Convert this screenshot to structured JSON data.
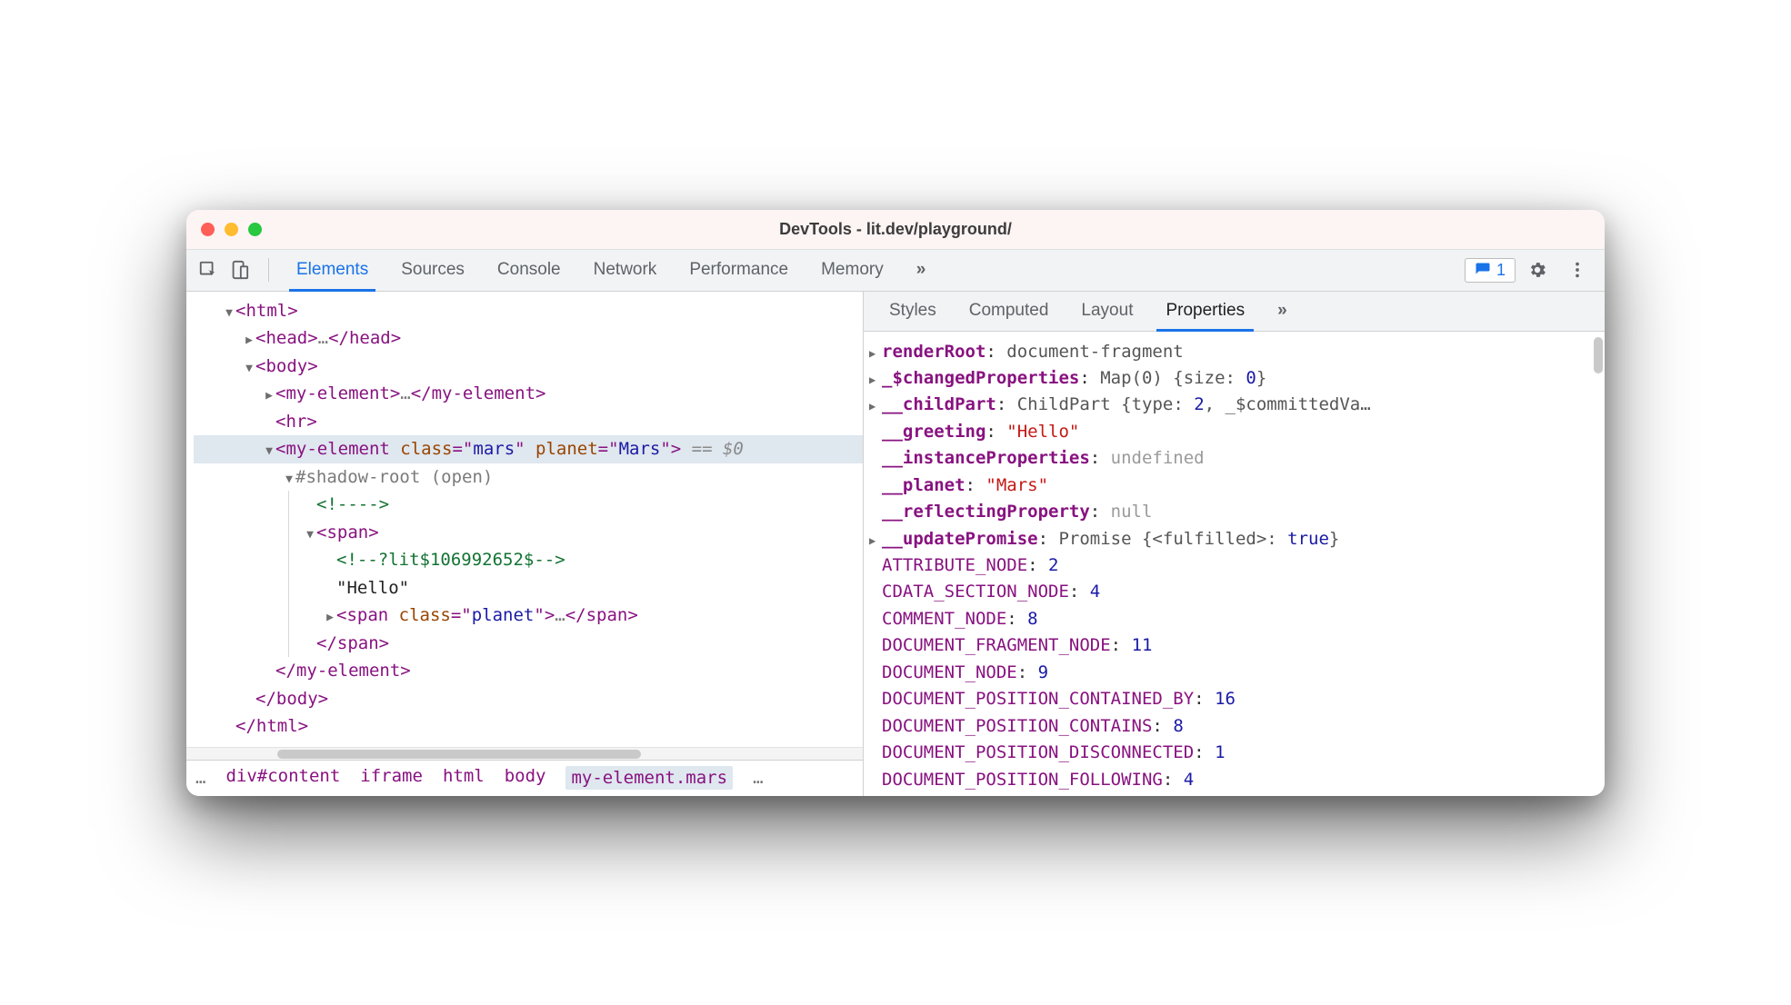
{
  "window": {
    "title": "DevTools - lit.dev/playground/"
  },
  "toolbar": {
    "tabs": [
      "Elements",
      "Sources",
      "Console",
      "Network",
      "Performance",
      "Memory"
    ],
    "active_tab": 0,
    "more": "»",
    "badge_count": "1"
  },
  "dom": {
    "lines": [
      {
        "indent": 1,
        "arrow": "down",
        "parts": [
          {
            "t": "tag",
            "v": "<html>"
          }
        ]
      },
      {
        "indent": 2,
        "arrow": "right",
        "parts": [
          {
            "t": "tag",
            "v": "<head>"
          },
          {
            "t": "gray",
            "v": "…"
          },
          {
            "t": "tag",
            "v": "</head>"
          }
        ]
      },
      {
        "indent": 2,
        "arrow": "down",
        "parts": [
          {
            "t": "tag",
            "v": "<body>"
          }
        ]
      },
      {
        "indent": 3,
        "arrow": "right",
        "parts": [
          {
            "t": "tag",
            "v": "<my-element>"
          },
          {
            "t": "gray",
            "v": "…"
          },
          {
            "t": "tag",
            "v": "</my-element>"
          }
        ]
      },
      {
        "indent": 3,
        "arrow": "",
        "parts": [
          {
            "t": "tag",
            "v": "<hr>"
          }
        ]
      },
      {
        "indent": 3,
        "arrow": "down",
        "selected": true,
        "parts": [
          {
            "t": "tag",
            "v": "<my-element "
          },
          {
            "t": "attr",
            "v": "class"
          },
          {
            "t": "tag",
            "v": "=\""
          },
          {
            "t": "val",
            "v": "mars"
          },
          {
            "t": "tag",
            "v": "\" "
          },
          {
            "t": "attr",
            "v": "planet"
          },
          {
            "t": "tag",
            "v": "=\""
          },
          {
            "t": "val",
            "v": "Mars"
          },
          {
            "t": "tag",
            "v": "\">"
          },
          {
            "t": "suffix",
            "v": " == $0"
          }
        ]
      },
      {
        "indent": 4,
        "arrow": "down",
        "parts": [
          {
            "t": "gray",
            "v": "#shadow-root (open)"
          }
        ]
      },
      {
        "indent": 5,
        "arrow": "",
        "guide": true,
        "parts": [
          {
            "t": "comment",
            "v": "<!---->"
          }
        ]
      },
      {
        "indent": 5,
        "arrow": "down",
        "guide": true,
        "parts": [
          {
            "t": "tag",
            "v": "<span>"
          }
        ]
      },
      {
        "indent": 6,
        "arrow": "",
        "guide": true,
        "parts": [
          {
            "t": "comment",
            "v": "<!--?lit$106992652$-->"
          }
        ]
      },
      {
        "indent": 6,
        "arrow": "",
        "guide": true,
        "parts": [
          {
            "t": "text",
            "v": "\"Hello\""
          }
        ]
      },
      {
        "indent": 6,
        "arrow": "right",
        "guide": true,
        "parts": [
          {
            "t": "tag",
            "v": "<span "
          },
          {
            "t": "attr",
            "v": "class"
          },
          {
            "t": "tag",
            "v": "=\""
          },
          {
            "t": "val",
            "v": "planet"
          },
          {
            "t": "tag",
            "v": "\">"
          },
          {
            "t": "gray",
            "v": "…"
          },
          {
            "t": "tag",
            "v": "</span>"
          }
        ]
      },
      {
        "indent": 5,
        "arrow": "",
        "guide": true,
        "parts": [
          {
            "t": "tag",
            "v": "</span>"
          }
        ]
      },
      {
        "indent": 3,
        "arrow": "",
        "parts": [
          {
            "t": "tag",
            "v": "</my-element>"
          }
        ]
      },
      {
        "indent": 2,
        "arrow": "",
        "parts": [
          {
            "t": "tag",
            "v": "</body>"
          }
        ]
      },
      {
        "indent": 1,
        "arrow": "",
        "parts": [
          {
            "t": "tag",
            "v": "</html>"
          }
        ]
      }
    ]
  },
  "breadcrumb": {
    "prefix": "…",
    "items": [
      "div#content",
      "iframe",
      "html",
      "body",
      "my-element.mars"
    ],
    "selected_index": 4,
    "suffix": "…"
  },
  "side_tabs": {
    "items": [
      "Styles",
      "Computed",
      "Layout",
      "Properties"
    ],
    "active_index": 3,
    "more": "»"
  },
  "properties": [
    {
      "arrow": "right",
      "key": "renderRoot",
      "bold": true,
      "colon": ":",
      "val": " document-fragment",
      "cls": "obj"
    },
    {
      "arrow": "right",
      "key": "_$changedProperties",
      "bold": true,
      "colon": ":",
      "val": " Map(0) {size: 0}",
      "cls": "objnum",
      "num_inside": "0"
    },
    {
      "arrow": "right",
      "key": "__childPart",
      "bold": true,
      "colon": ":",
      "val": " ChildPart {type: 2, _$committedVa…",
      "cls": "objmix"
    },
    {
      "arrow": "",
      "key": "__greeting",
      "bold": true,
      "colon": ":",
      "val": " \"Hello\"",
      "cls": "str"
    },
    {
      "arrow": "",
      "key": "__instanceProperties",
      "bold": true,
      "colon": ":",
      "val": " undefined",
      "cls": "gray"
    },
    {
      "arrow": "",
      "key": "__planet",
      "bold": true,
      "colon": ":",
      "val": " \"Mars\"",
      "cls": "str"
    },
    {
      "arrow": "",
      "key": "__reflectingProperty",
      "bold": true,
      "colon": ":",
      "val": " null",
      "cls": "gray"
    },
    {
      "arrow": "right",
      "key": "__updatePromise",
      "bold": true,
      "colon": ":",
      "val": " Promise {<fulfilled>: true}",
      "cls": "promise"
    },
    {
      "arrow": "",
      "key": "ATTRIBUTE_NODE",
      "colon": ":",
      "val": " 2",
      "cls": "num"
    },
    {
      "arrow": "",
      "key": "CDATA_SECTION_NODE",
      "colon": ":",
      "val": " 4",
      "cls": "num"
    },
    {
      "arrow": "",
      "key": "COMMENT_NODE",
      "colon": ":",
      "val": " 8",
      "cls": "num"
    },
    {
      "arrow": "",
      "key": "DOCUMENT_FRAGMENT_NODE",
      "colon": ":",
      "val": " 11",
      "cls": "num"
    },
    {
      "arrow": "",
      "key": "DOCUMENT_NODE",
      "colon": ":",
      "val": " 9",
      "cls": "num"
    },
    {
      "arrow": "",
      "key": "DOCUMENT_POSITION_CONTAINED_BY",
      "colon": ":",
      "val": " 16",
      "cls": "num"
    },
    {
      "arrow": "",
      "key": "DOCUMENT_POSITION_CONTAINS",
      "colon": ":",
      "val": " 8",
      "cls": "num"
    },
    {
      "arrow": "",
      "key": "DOCUMENT_POSITION_DISCONNECTED",
      "colon": ":",
      "val": " 1",
      "cls": "num"
    },
    {
      "arrow": "",
      "key": "DOCUMENT_POSITION_FOLLOWING",
      "colon": ":",
      "val": " 4",
      "cls": "num"
    }
  ]
}
